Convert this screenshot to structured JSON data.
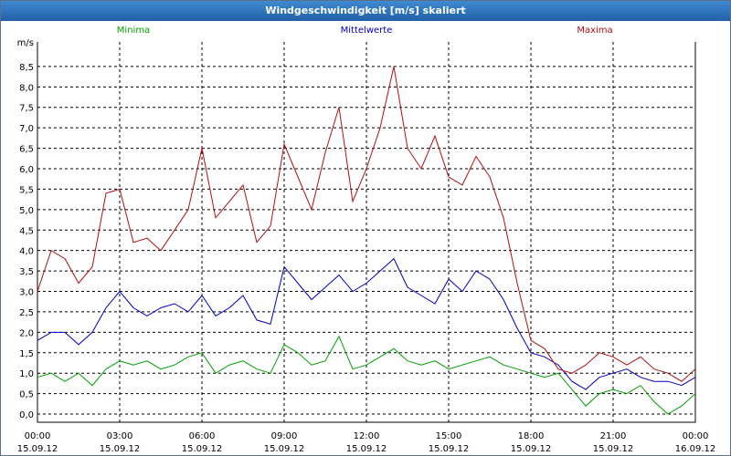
{
  "window": {
    "title": "Windgeschwindigkeit [m/s] skaliert"
  },
  "chart_data": {
    "type": "line",
    "title": "Windgeschwindigkeit [m/s] skaliert",
    "xlabel": "",
    "ylabel": "m/s",
    "ylim": [
      -0.2,
      9.1
    ],
    "yticks": [
      "0,0",
      "0,5",
      "1,0",
      "1,5",
      "2,0",
      "2,5",
      "3,0",
      "3,5",
      "4,0",
      "4,5",
      "5,0",
      "5,5",
      "6,0",
      "6,5",
      "7,0",
      "7,5",
      "8,0",
      "8,5"
    ],
    "xticks": [
      {
        "time": "00:00",
        "date": "15.09.12"
      },
      {
        "time": "03:00",
        "date": "15.09.12"
      },
      {
        "time": "06:00",
        "date": "15.09.12"
      },
      {
        "time": "09:00",
        "date": "15.09.12"
      },
      {
        "time": "12:00",
        "date": "15.09.12"
      },
      {
        "time": "15:00",
        "date": "15.09.12"
      },
      {
        "time": "18:00",
        "date": "15.09.12"
      },
      {
        "time": "21:00",
        "date": "15.09.12"
      },
      {
        "time": "00:00",
        "date": "16.09.12"
      }
    ],
    "grid": true,
    "legend_position": "top",
    "x_hours": [
      0,
      0.5,
      1,
      1.5,
      2,
      2.5,
      3,
      3.5,
      4,
      4.5,
      5,
      5.5,
      6,
      6.5,
      7,
      7.5,
      8,
      8.5,
      9,
      9.5,
      10,
      10.5,
      11,
      11.5,
      12,
      12.5,
      13,
      13.5,
      14,
      14.5,
      15,
      15.5,
      16,
      16.5,
      17,
      17.5,
      18,
      18.5,
      19,
      19.5,
      20,
      20.5,
      21,
      21.5,
      22,
      22.5,
      23,
      23.5,
      24
    ],
    "series": [
      {
        "name": "Minima",
        "color": "#00a000",
        "values": [
          0.9,
          1.0,
          0.8,
          1.0,
          0.7,
          1.1,
          1.3,
          1.2,
          1.3,
          1.1,
          1.2,
          1.4,
          1.5,
          1.0,
          1.2,
          1.3,
          1.1,
          1.0,
          1.7,
          1.5,
          1.2,
          1.3,
          1.9,
          1.1,
          1.2,
          1.4,
          1.6,
          1.3,
          1.2,
          1.3,
          1.1,
          1.2,
          1.3,
          1.4,
          1.2,
          1.1,
          1.0,
          0.9,
          1.0,
          0.6,
          0.2,
          0.5,
          0.6,
          0.5,
          0.7,
          0.3,
          0.0,
          0.2,
          0.5
        ]
      },
      {
        "name": "Mittelwerte",
        "color": "#0000c0",
        "values": [
          1.8,
          2.0,
          2.0,
          1.7,
          2.0,
          2.6,
          3.0,
          2.6,
          2.4,
          2.6,
          2.7,
          2.5,
          2.9,
          2.4,
          2.6,
          2.9,
          2.3,
          2.2,
          3.6,
          3.2,
          2.8,
          3.1,
          3.4,
          3.0,
          3.2,
          3.5,
          3.8,
          3.1,
          2.9,
          2.7,
          3.3,
          3.0,
          3.5,
          3.3,
          2.8,
          2.1,
          1.5,
          1.4,
          1.2,
          0.8,
          0.6,
          0.9,
          1.0,
          1.1,
          0.9,
          0.8,
          0.8,
          0.7,
          0.9
        ]
      },
      {
        "name": "Maxima",
        "color": "#b01010",
        "values": [
          3.0,
          4.0,
          3.8,
          3.2,
          3.6,
          5.4,
          5.5,
          4.2,
          4.3,
          4.0,
          4.5,
          5.0,
          6.5,
          4.8,
          5.2,
          5.6,
          4.2,
          4.6,
          6.6,
          5.8,
          5.0,
          6.4,
          7.5,
          5.2,
          6.0,
          7.0,
          8.5,
          6.5,
          6.0,
          6.8,
          5.8,
          5.6,
          6.3,
          5.8,
          4.8,
          3.2,
          1.8,
          1.6,
          1.1,
          1.0,
          1.2,
          1.5,
          1.4,
          1.2,
          1.4,
          1.1,
          1.0,
          0.8,
          1.1
        ]
      }
    ]
  }
}
